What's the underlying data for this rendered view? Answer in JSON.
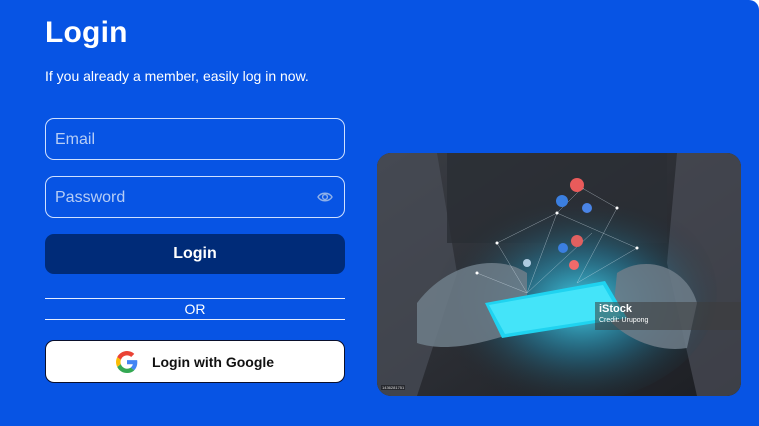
{
  "login": {
    "title": "Login",
    "subtitle": "If you already a member, easily log in now.",
    "email_placeholder": "Email",
    "password_placeholder": "Password",
    "login_button": "Login",
    "divider_text": "OR",
    "google_button": "Login with Google"
  },
  "image": {
    "watermark_brand": "iStock",
    "watermark_credit": "Credit: Urupong",
    "stock_id": "1436281751"
  },
  "colors": {
    "background": "#0754e4",
    "login_button": "#002b78",
    "google_button_bg": "#ffffff"
  },
  "icons": [
    "eye-icon",
    "google-logo-icon"
  ]
}
